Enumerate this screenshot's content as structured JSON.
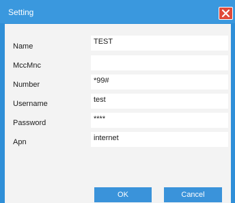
{
  "window": {
    "title": "Setting",
    "close_icon": "close-icon"
  },
  "form": {
    "fields": [
      {
        "label": "Name",
        "value": "TEST"
      },
      {
        "label": "MccMnc",
        "value": ""
      },
      {
        "label": "Number",
        "value": "*99#"
      },
      {
        "label": "Username",
        "value": "test"
      },
      {
        "label": "Password",
        "value": "****"
      },
      {
        "label": "Apn",
        "value": "internet"
      }
    ]
  },
  "buttons": {
    "ok_label": "OK",
    "cancel_label": "Cancel"
  },
  "colors": {
    "frame": "#2f8fd8",
    "button": "#3a93da",
    "close": "#e04a3a",
    "client": "#f3f3f3"
  }
}
